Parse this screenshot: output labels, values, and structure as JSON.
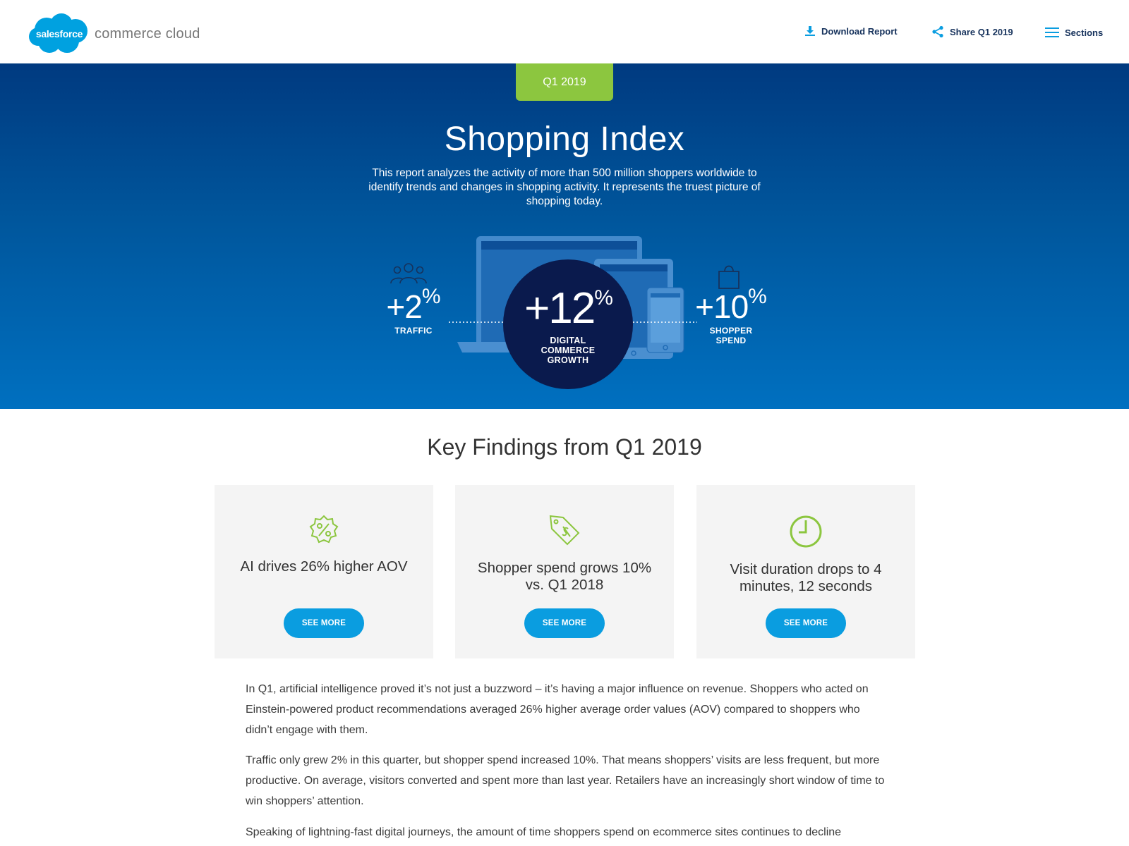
{
  "header": {
    "logo_brand": "salesforce",
    "logo_product": "commerce cloud",
    "nav": {
      "download": "Download Report",
      "share": "Share Q1 2019",
      "sections": "Sections"
    }
  },
  "hero": {
    "quarter": "Q1 2019",
    "title": "Shopping Index",
    "description": "This report analyzes the activity of more than 500 million shoppers worldwide to identify trends and changes in shopping activity. It represents the truest picture of shopping today.",
    "stats": {
      "traffic": {
        "value": "+2",
        "unit": "%",
        "label": "TRAFFIC"
      },
      "growth": {
        "value": "+12",
        "unit": "%",
        "label_line1": "DIGITAL",
        "label_line2": "COMMERCE",
        "label_line3": "GROWTH"
      },
      "spend": {
        "value": "+10",
        "unit": "%",
        "label_line1": "SHOPPER",
        "label_line2": "SPEND"
      }
    }
  },
  "key_findings": {
    "title": "Key Findings from Q1 2019",
    "cards": [
      {
        "text": "AI drives 26% higher AOV",
        "button": "SEE MORE",
        "icon": "percent-badge-icon"
      },
      {
        "text": "Shopper spend grows 10% vs. Q1 2018",
        "button": "SEE MORE",
        "icon": "price-tag-icon"
      },
      {
        "text": "Visit duration drops to 4 minutes, 12 seconds",
        "button": "SEE MORE",
        "icon": "clock-icon"
      }
    ]
  },
  "body": {
    "paragraphs": [
      "In Q1, artificial intelligence proved it’s not just a buzzword – it’s having a major influence on revenue. Shoppers who acted on Einstein-powered product recommendations averaged 26% higher average order values (AOV) compared to shoppers who didn’t engage with them.",
      "Traffic only grew 2% in this quarter, but shopper spend increased 10%. That means shoppers’ visits are less frequent, but more productive. On average, visitors converted and spent more than last year. Retailers have an increasingly short window of time to win shoppers’ attention.",
      "Speaking of lightning-fast digital journeys, the amount of time shoppers spend on ecommerce sites continues to decline"
    ]
  },
  "colors": {
    "hero_top": "#003a80",
    "hero_bottom": "#0070c0",
    "quarter_tab": "#8cc63f",
    "accent_button": "#0a9de0",
    "circle": "#0a1a4d",
    "card_bg": "#f4f4f4"
  }
}
